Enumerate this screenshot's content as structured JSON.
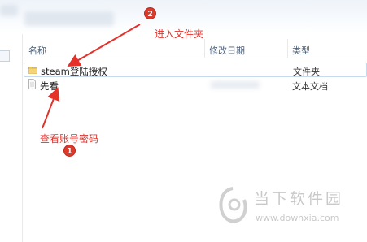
{
  "header": {
    "col_name": "名称",
    "col_date": "修改日期",
    "col_type": "类型"
  },
  "rows": [
    {
      "name": "steam登陆授权",
      "type": "文件夹",
      "icon": "folder-icon"
    },
    {
      "name": "先看",
      "type": "文本文档",
      "icon": "text-file-icon"
    }
  ],
  "annotations": {
    "enter_folder": "进入文件夹",
    "enter_folder_step": "2",
    "view_account": "查看账号密码",
    "view_account_step": "1",
    "color": "#e4322b"
  },
  "watermark": {
    "title": "当下软件园",
    "url": "www.downxia.com"
  }
}
